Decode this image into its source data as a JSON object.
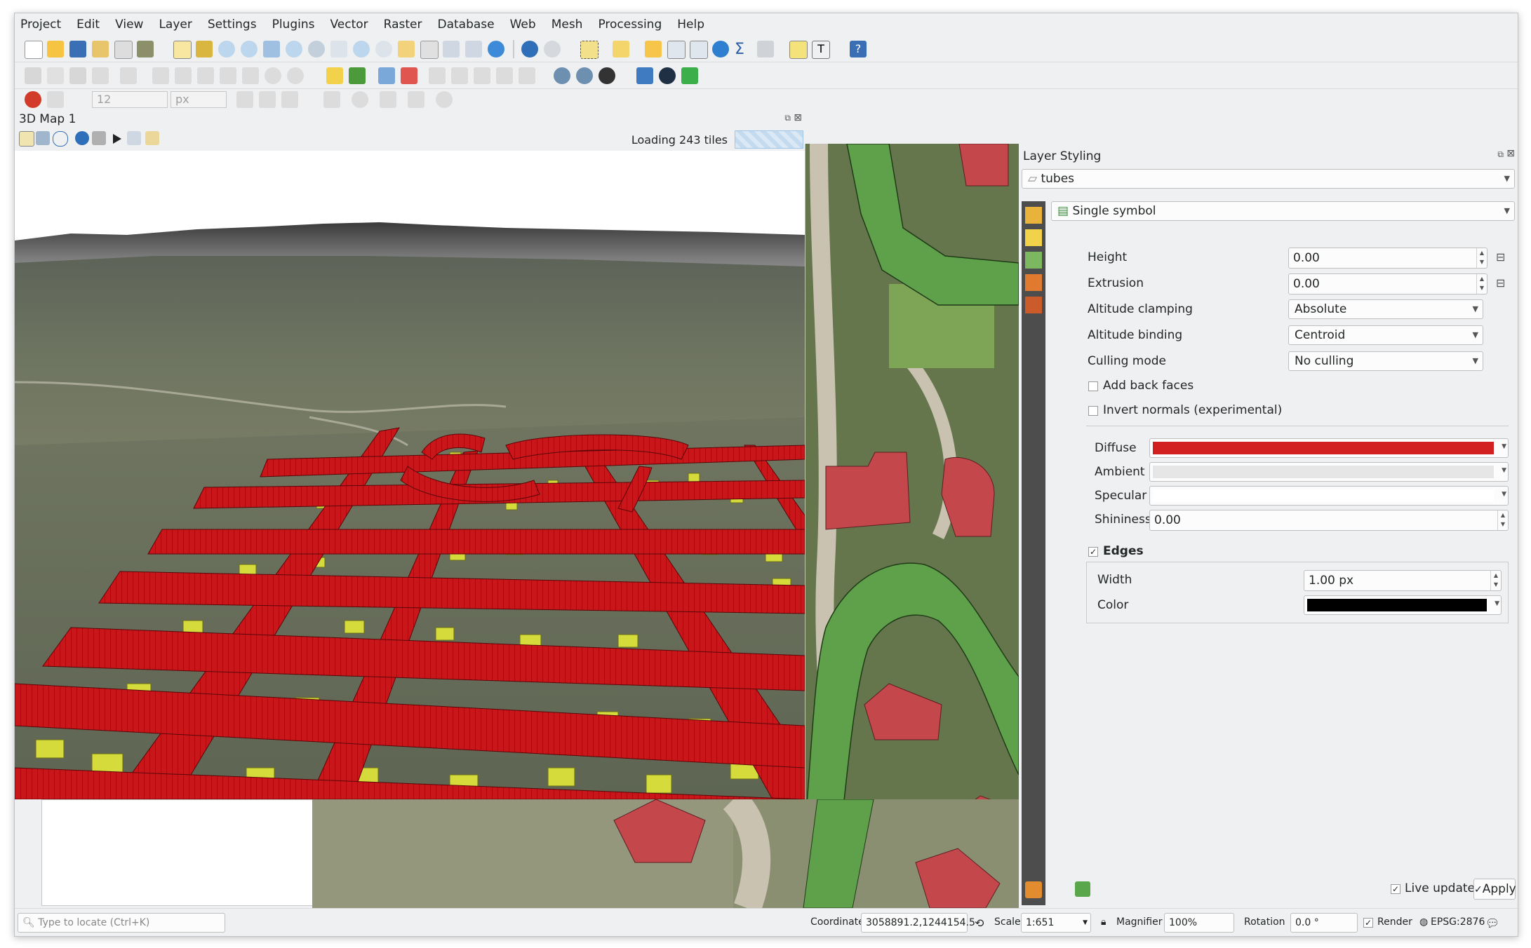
{
  "menu": [
    "Project",
    "Edit",
    "View",
    "Layer",
    "Settings",
    "Plugins",
    "Vector",
    "Raster",
    "Database",
    "Web",
    "Mesh",
    "Processing",
    "Help"
  ],
  "digitizing": {
    "snap_value": "12",
    "snap_unit": "px"
  },
  "map3d": {
    "title": "3D Map 1",
    "loading": "Loading 243 tiles"
  },
  "styling": {
    "title": "Layer Styling",
    "layer": "tubes",
    "renderer": "Single symbol",
    "height": {
      "label": "Height",
      "value": "0.00"
    },
    "extrusion": {
      "label": "Extrusion",
      "value": "0.00"
    },
    "altitude_clamping": {
      "label": "Altitude clamping",
      "value": "Absolute"
    },
    "altitude_binding": {
      "label": "Altitude binding",
      "value": "Centroid"
    },
    "culling_mode": {
      "label": "Culling mode",
      "value": "No culling"
    },
    "add_back_faces": "Add back faces",
    "invert_normals": "Invert normals (experimental)",
    "diffuse": {
      "label": "Diffuse",
      "color": "#d21f1f"
    },
    "ambient": {
      "label": "Ambient",
      "color": "#e6e6e6"
    },
    "specular": {
      "label": "Specular",
      "color": "#ffffff"
    },
    "shininess": {
      "label": "Shininess",
      "value": "0.00"
    },
    "edges": {
      "label": "Edges",
      "width_label": "Width",
      "width_value": "1.00 px",
      "color_label": "Color",
      "color": "#000000"
    },
    "live_update": "Live update",
    "apply": "Apply"
  },
  "status": {
    "locate_placeholder": "Type to locate (Ctrl+K)",
    "coordinate_label": "Coordinate",
    "coordinate_value": "3058891.2,1244154.5",
    "scale_label": "Scale",
    "scale_value": "1:651",
    "magnifier_label": "Magnifier",
    "magnifier_value": "100%",
    "rotation_label": "Rotation",
    "rotation_value": "0.0 °",
    "render_label": "Render",
    "crs": "EPSG:2876"
  },
  "colors": {
    "tube_red": "#c8161b",
    "building_yellow": "#d4db3a",
    "house_red": "#c4474c",
    "tube_green": "#5fa14a"
  }
}
